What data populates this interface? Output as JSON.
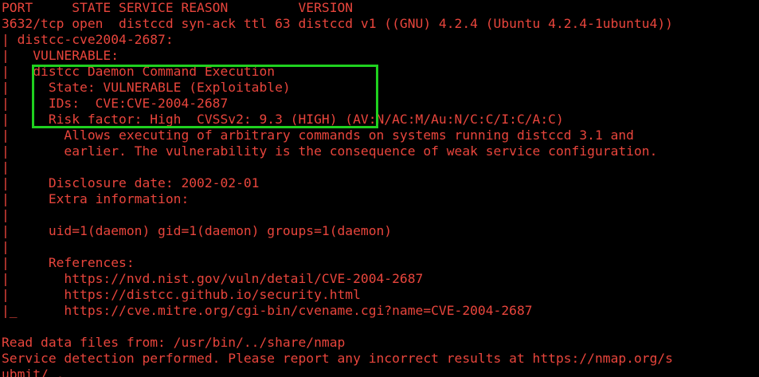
{
  "terminal": {
    "text_color": "#e8453c",
    "background": "#000000",
    "highlight_color": "#1fd11f",
    "lines": [
      "PORT     STATE SERVICE REASON         VERSION",
      "3632/tcp open  distccd syn-ack ttl 63 distccd v1 ((GNU) 4.2.4 (Ubuntu 4.2.4-1ubuntu4))",
      "| distcc-cve2004-2687:",
      "|   VULNERABLE:",
      "|   distcc Daemon Command Execution",
      "|     State: VULNERABLE (Exploitable)",
      "|     IDs:  CVE:CVE-2004-2687",
      "|     Risk factor: High  CVSSv2: 9.3 (HIGH) (AV:N/AC:M/Au:N/C:C/I:C/A:C)",
      "|       Allows executing of arbitrary commands on systems running distccd 3.1 and",
      "|       earlier. The vulnerability is the consequence of weak service configuration.",
      "|",
      "|     Disclosure date: 2002-02-01",
      "|     Extra information:",
      "|",
      "|     uid=1(daemon) gid=1(daemon) groups=1(daemon)",
      "|",
      "|     References:",
      "|       https://nvd.nist.gov/vuln/detail/CVE-2004-2687",
      "|       https://distcc.github.io/security.html",
      "|_      https://cve.mitre.org/cgi-bin/cvename.cgi?name=CVE-2004-2687",
      "",
      "Read data files from: /usr/bin/../share/nmap",
      "Service detection performed. Please report any incorrect results at https://nmap.org/s",
      "ubmit/ ."
    ]
  }
}
